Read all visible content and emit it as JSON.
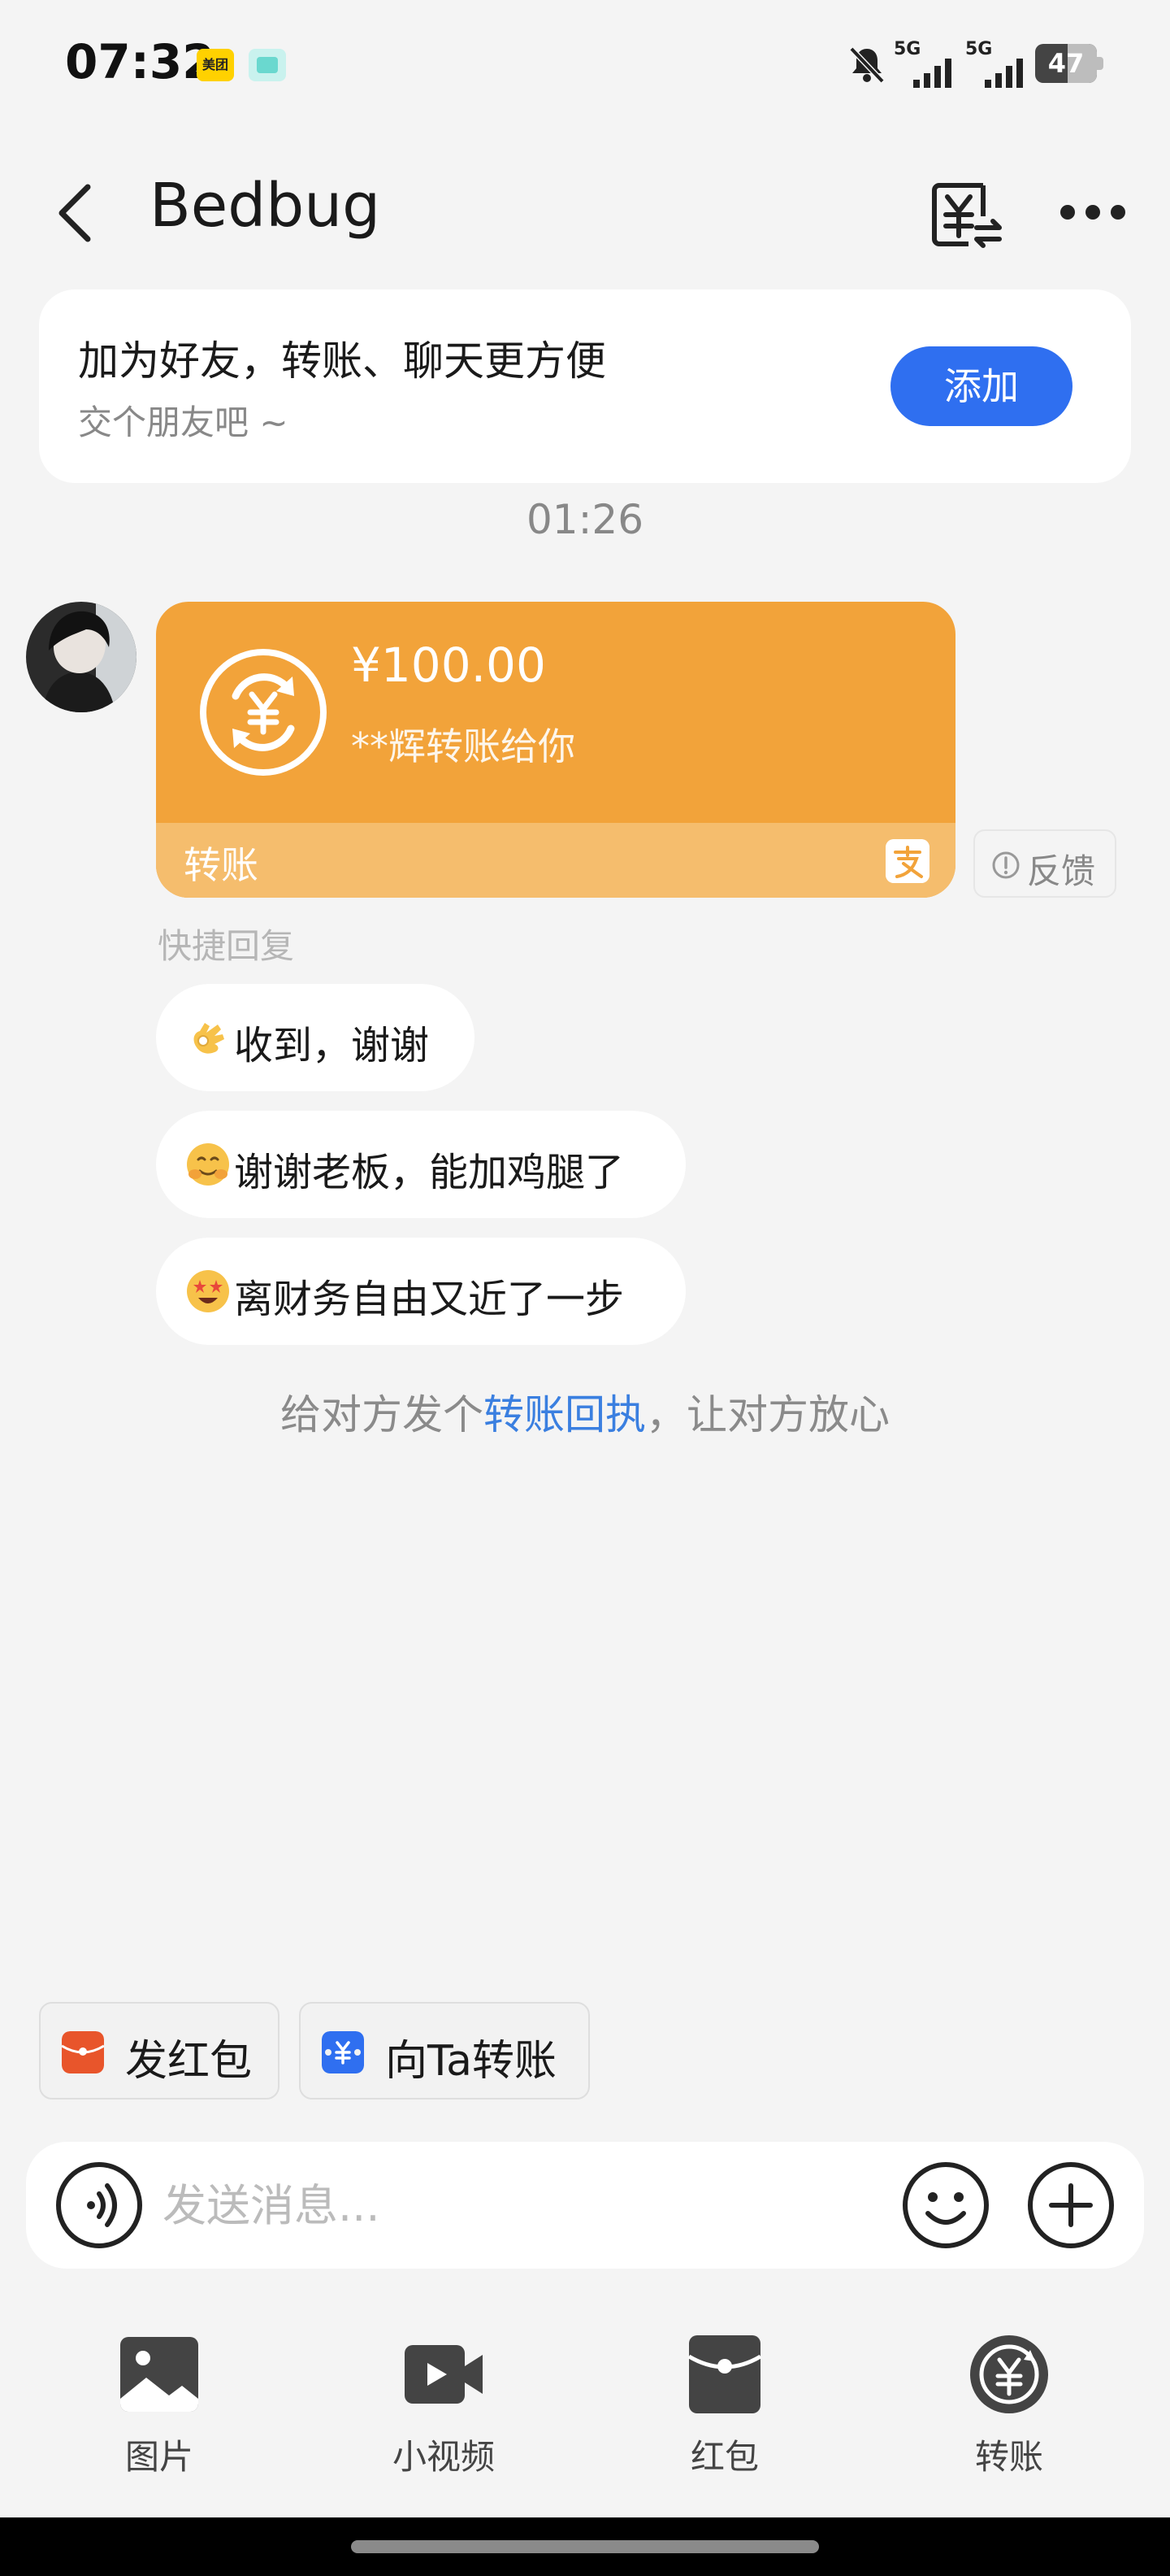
{
  "status_bar": {
    "time": "07:32",
    "app_badge_1": "美团",
    "signal_1_label": "5G",
    "signal_2_label": "5G",
    "battery": "47"
  },
  "header": {
    "back_icon": "chevron-left-icon",
    "title": "Bedbug",
    "transfer_icon": "yuan-exchange-icon",
    "more_icon": "more-dots-icon"
  },
  "friend_card": {
    "title": "加为好友，转账、聊天更方便",
    "subtitle": "交个朋友吧 ~",
    "add_button": "添加"
  },
  "timestamp": "01:26",
  "transfer_message": {
    "amount": "¥100.00",
    "description": "**辉转账给你",
    "footer_label": "转账",
    "feedback": "反馈"
  },
  "quick_reply": {
    "label": "快捷回复",
    "items": [
      {
        "text": "收到，谢谢",
        "emoji": "ok-hand-emoji"
      },
      {
        "text": "谢谢老板，能加鸡腿了",
        "emoji": "yum-face-emoji"
      },
      {
        "text": "离财务自由又近了一步",
        "emoji": "star-eyes-emoji"
      }
    ]
  },
  "receipt_hint": {
    "prefix": "给对方发个",
    "link": "转账回执",
    "suffix": "，让对方放心"
  },
  "shortcuts": {
    "red_packet": "发红包",
    "transfer_to": "向Ta转账"
  },
  "input": {
    "placeholder": "发送消息..."
  },
  "tools": [
    {
      "label": "图片",
      "icon": "image-icon"
    },
    {
      "label": "小视频",
      "icon": "video-icon"
    },
    {
      "label": "红包",
      "icon": "red-packet-icon"
    },
    {
      "label": "转账",
      "icon": "transfer-icon"
    }
  ],
  "colors": {
    "accent_blue": "#2f6ff0",
    "transfer_orange": "#f2a33a",
    "transfer_footer": "#f5bd6d",
    "link_blue": "#3a7fe0",
    "red_packet": "#e8552b"
  }
}
